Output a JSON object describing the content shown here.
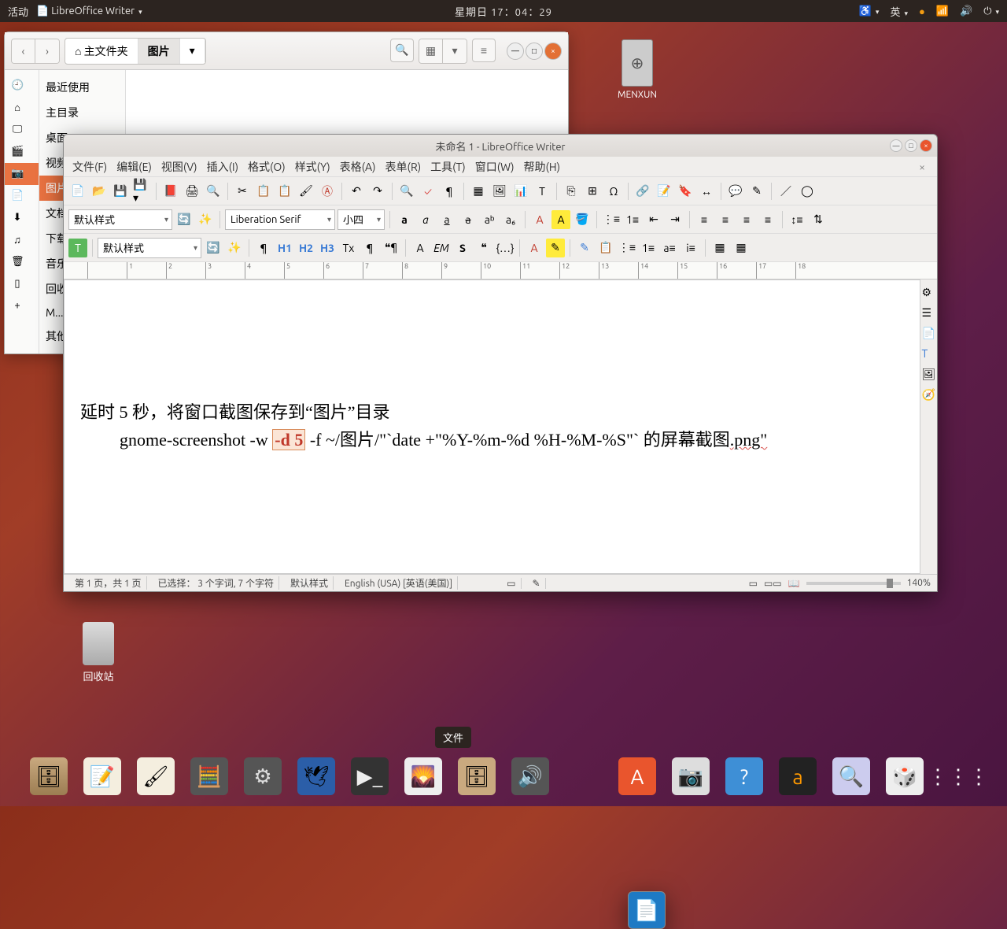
{
  "topbar": {
    "activities": "活动",
    "app_indicator": "LibreOffice Writer",
    "clock": "星期日 17：04：29",
    "ime": "英"
  },
  "desktop": {
    "usb_label": "MENXUN",
    "trash_label": "回收站"
  },
  "nautilus": {
    "path_home": "主文件夹",
    "path_pictures": "图片",
    "sidebar": {
      "recent": "最近使用",
      "home": "主目录",
      "desktop": "桌面",
      "videos": "视频",
      "pictures": "图片",
      "documents": "文档",
      "downloads": "下载",
      "music": "音乐",
      "trash": "回收站",
      "menxun": "M...",
      "other": "其他"
    }
  },
  "writer": {
    "title": "未命名 1 - LibreOffice Writer",
    "menu": {
      "file": "文件(F)",
      "edit": "编辑(E)",
      "view": "视图(V)",
      "insert": "插入(I)",
      "format": "格式(O)",
      "styles": "样式(Y)",
      "table": "表格(A)",
      "form": "表单(R)",
      "tools": "工具(T)",
      "window": "窗口(W)",
      "help": "帮助(H)"
    },
    "combo_style": "默认样式",
    "combo_font": "Liberation Serif",
    "combo_size": "小四",
    "combo_style2": "默认样式",
    "tb2": {
      "h1": "H1",
      "h2": "H2",
      "h3": "H3",
      "tx": "Tx",
      "a": "A",
      "em": "EM",
      "s": "S"
    },
    "doc": {
      "line1": "延时 5 秒，将窗口截图保存到“图片”目录",
      "line2_a": "gnome-screenshot -w ",
      "line2_sel": "-d 5",
      "line2_b": " -f ~/图片/\"`date +\"%Y-%m-%d %H-%M-%S\"` 的屏幕截图",
      "line2_c": ".png\""
    },
    "status": {
      "page": "第 1 页，共 1 页",
      "sel": "已选择：  3 个字词, 7 个字符",
      "style": "默认样式",
      "lang": "English (USA) [英语(美国)]",
      "zoom": "140%"
    }
  },
  "dock": {
    "tooltip": "文件"
  }
}
